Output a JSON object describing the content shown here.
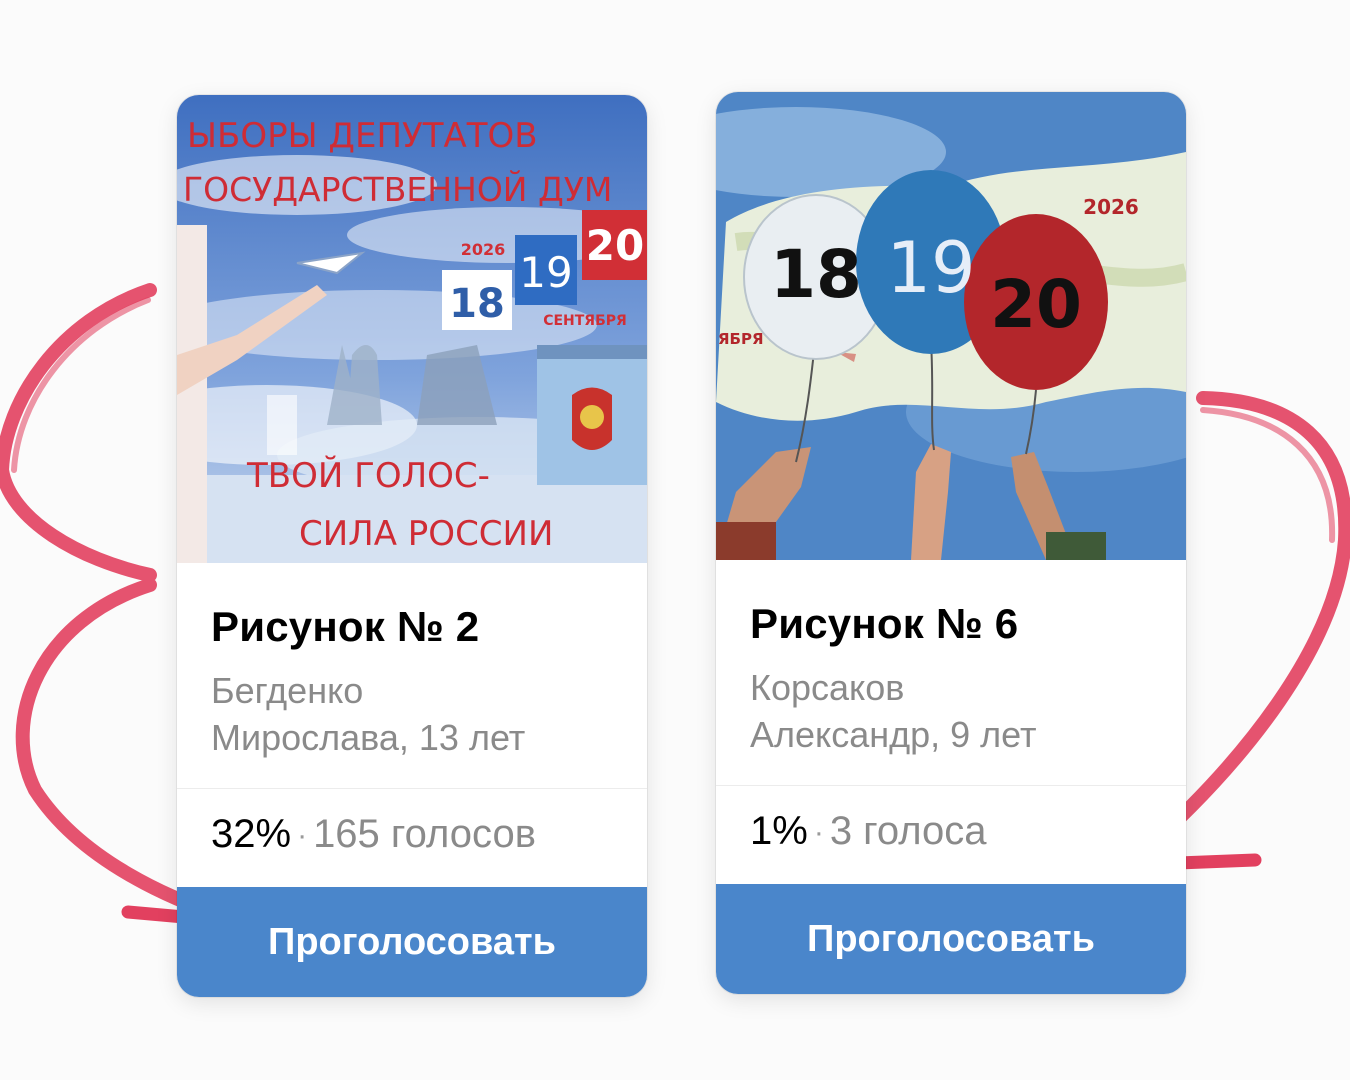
{
  "colors": {
    "button_bg": "#4a86cb",
    "button_text": "#ffffff",
    "annotation_arrow": "#e2405f"
  },
  "cards": [
    {
      "artwork_text": {
        "headline_line1": "ЫБОРЫ ДЕПУТАТОВ",
        "headline_line2": "ГОСУДАРСТВЕННОЙ ДУМ",
        "year": "2026",
        "day_1": "18",
        "day_2": "19",
        "day_3": "20",
        "month": "СЕНТЯБРЯ",
        "slogan_line1": "ТВОЙ ГОЛОС-",
        "slogan_line2": "СИЛА РОССИИ"
      },
      "title": "Рисунок № 2",
      "author_line1": "Бегденко",
      "author_line2": "Мирослава, 13 лет",
      "percent": "32%",
      "separator": "·",
      "votes": "165 голосов",
      "button_label": "Проголосовать"
    },
    {
      "artwork_text": {
        "year": "2026",
        "day_1": "18",
        "day_2": "19",
        "day_3": "20",
        "month_fragment": "ЯБРЯ"
      },
      "title": "Рисунок № 6",
      "author_line1": "Корсаков",
      "author_line2": "Александр, 9 лет",
      "percent": "1%",
      "separator": "·",
      "votes": "3 голоса",
      "button_label": "Проголосовать"
    }
  ]
}
